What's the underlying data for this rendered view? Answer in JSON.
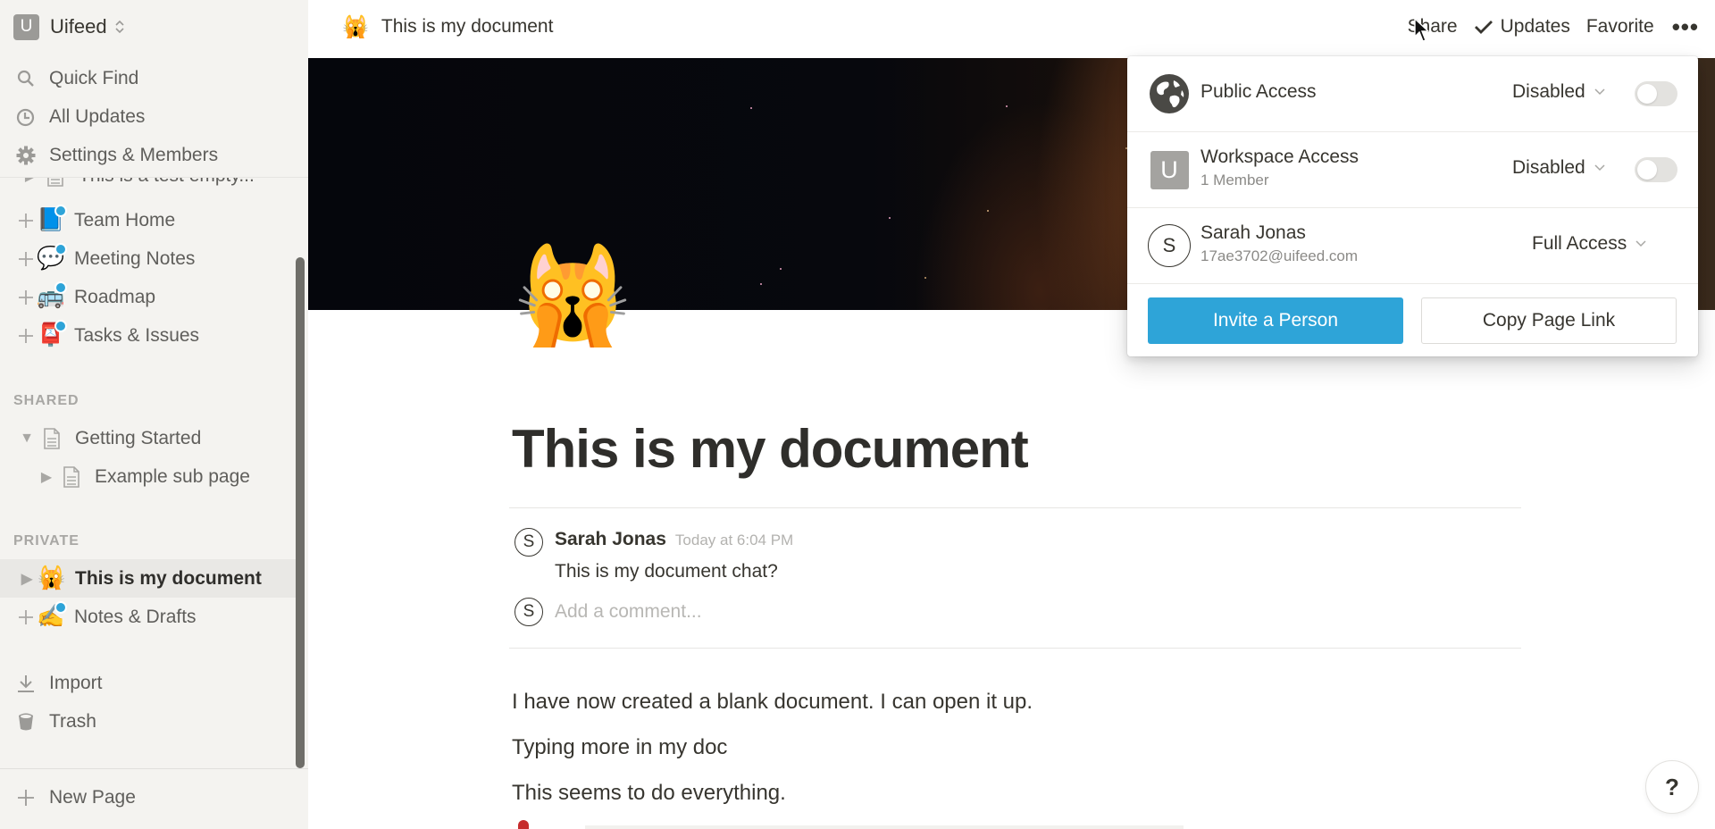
{
  "workspace": {
    "initial": "U",
    "name": "Uifeed"
  },
  "sidebar": {
    "nav": [
      {
        "label": "Quick Find",
        "icon": "search-icon"
      },
      {
        "label": "All Updates",
        "icon": "clock-icon"
      },
      {
        "label": "Settings & Members",
        "icon": "gear-icon"
      }
    ],
    "partial_item": {
      "label": "This is a test empty...",
      "icon": "page-icon"
    },
    "workspace_pages": [
      {
        "label": "Team Home",
        "emoji": "📘",
        "icon": "book-icon"
      },
      {
        "label": "Meeting Notes",
        "emoji": "💬",
        "icon": "speech-bubble-icon"
      },
      {
        "label": "Roadmap",
        "emoji": "🚌",
        "icon": "bus-icon"
      },
      {
        "label": "Tasks & Issues",
        "emoji": "📮",
        "icon": "mailbox-icon"
      }
    ],
    "shared_label": "SHARED",
    "shared_pages": [
      {
        "label": "Getting Started",
        "icon": "page-icon",
        "expanded": true
      },
      {
        "label": "Example sub page",
        "icon": "page-icon",
        "expanded": false
      }
    ],
    "private_label": "PRIVATE",
    "private_pages": [
      {
        "label": "This is my document",
        "emoji": "🙀",
        "active": true
      },
      {
        "label": "Notes & Drafts",
        "emoji": "✍️"
      }
    ],
    "import_label": "Import",
    "trash_label": "Trash",
    "new_page_label": "New Page"
  },
  "topbar": {
    "page_emoji": "🙀",
    "page_title": "This is my document",
    "share_label": "Share",
    "updates_label": "Updates",
    "favorite_label": "Favorite",
    "more_label": "•••"
  },
  "page": {
    "icon": "🙀",
    "title": "This is my document",
    "comment": {
      "avatar_initial": "S",
      "author": "Sarah Jonas",
      "time": "Today at 6:04 PM",
      "text": "This is my document chat?"
    },
    "comment_input": {
      "avatar_initial": "S",
      "placeholder": "Add a comment..."
    },
    "paragraphs": [
      "I have now created a blank document. I can open it up.",
      "Typing more in my doc",
      "This seems to do everything."
    ]
  },
  "share_popup": {
    "public_access": {
      "label": "Public Access",
      "value": "Disabled",
      "enabled": false
    },
    "workspace_access": {
      "initial": "U",
      "label": "Workspace Access",
      "sub": "1 Member",
      "value": "Disabled",
      "enabled": false
    },
    "member": {
      "initial": "S",
      "name": "Sarah Jonas",
      "email": "17ae3702@uifeed.com",
      "value": "Full Access"
    },
    "invite_label": "Invite a Person",
    "copy_link_label": "Copy Page Link"
  },
  "help": {
    "label": "?"
  },
  "colors": {
    "accent": "#2ea4d8",
    "sidebar_bg": "#f4f3f0",
    "text": "#37352f"
  }
}
